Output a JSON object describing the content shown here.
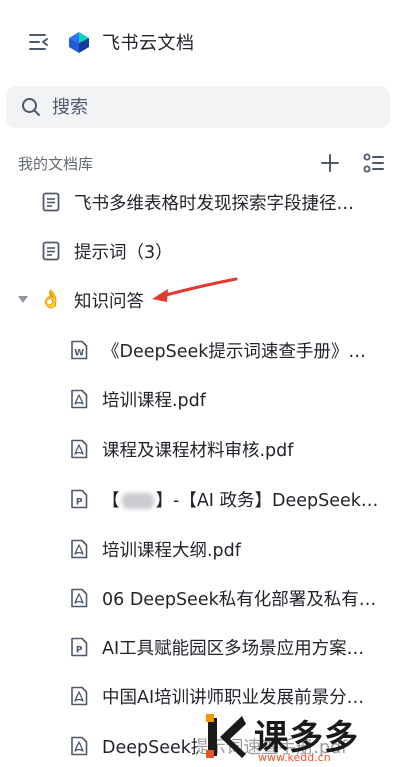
{
  "header": {
    "app_title": "飞书云文档"
  },
  "search": {
    "placeholder": "搜索"
  },
  "library": {
    "section_label": "我的文档库"
  },
  "tree": {
    "top_items": [
      {
        "label": "飞书多维表格时发现探索字段捷径…",
        "icon": "doc-icon"
      },
      {
        "label": "提示词（3）",
        "icon": "doc-icon"
      }
    ],
    "folder": {
      "label": "知识问答",
      "icon": "ok-hand-emoji",
      "emoji": "👌",
      "expanded": true
    },
    "children": [
      {
        "label": "《DeepSeek提示词速查手册》…",
        "icon": "word-file-icon"
      },
      {
        "label": "培训课程.pdf",
        "icon": "pdf-file-icon"
      },
      {
        "label": "课程及课程材料审核.pdf",
        "icon": "pdf-file-icon"
      },
      {
        "label_prefix": "【",
        "label_suffix": "】-【AI 政务】DeepSeek…",
        "icon": "ppt-file-icon"
      },
      {
        "label": "培训课程大纲.pdf",
        "icon": "pdf-file-icon"
      },
      {
        "label": "06 DeepSeek私有化部署及私有…",
        "icon": "pdf-file-icon"
      },
      {
        "label": "AI工具赋能园区多场景应用方案…",
        "icon": "ppt-file-icon"
      },
      {
        "label": "中国AI培训讲师职业发展前景分…",
        "icon": "pdf-file-icon"
      },
      {
        "label": "DeepSeek提示词速查手册.pdf",
        "icon": "pdf-file-icon"
      }
    ]
  },
  "watermark": {
    "text": "课多多",
    "url": "www.kedd.cn"
  },
  "colors": {
    "text": "#1f2329",
    "muted": "#646a73",
    "search_bg": "#f2f3f5",
    "annotation_arrow": "#e03a2f"
  }
}
